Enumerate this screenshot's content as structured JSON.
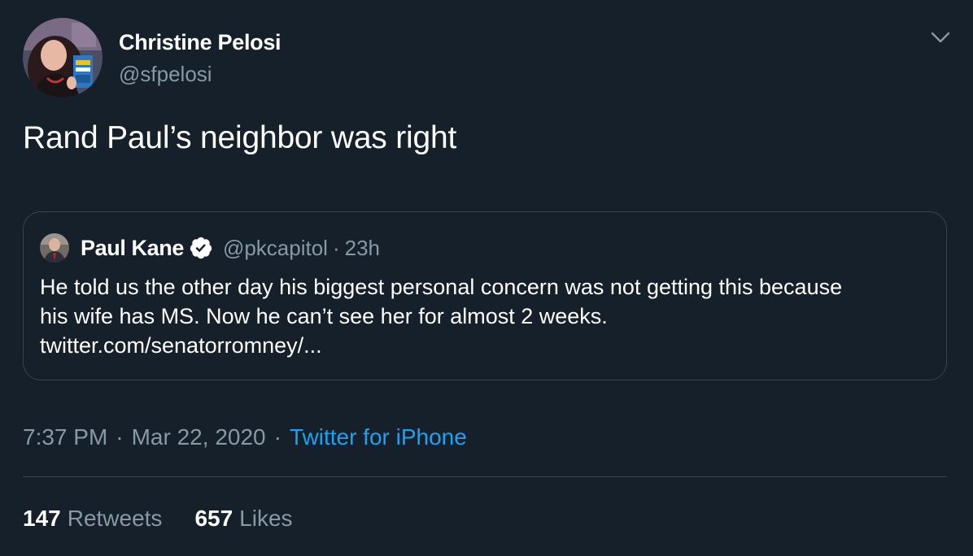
{
  "tweet": {
    "author": {
      "display_name": "Christine Pelosi",
      "handle": "@sfpelosi"
    },
    "text": "Rand Paul’s neighbor was right",
    "quoted_tweet": {
      "display_name": "Paul Kane",
      "handle": "@pkcapitol",
      "separator": "·",
      "time_ago": "23h",
      "body_lines": [
        "He told us the other day his biggest personal concern was not getting this because",
        "his wife has MS. Now he can’t see her for almost 2 weeks.",
        "twitter.com/senatorromney/..."
      ]
    },
    "meta": {
      "time": "7:37 PM",
      "separator": "·",
      "date": "Mar 22, 2020",
      "source": "Twitter for iPhone"
    },
    "stats": {
      "retweets_count": "147",
      "retweets_label": "Retweets",
      "likes_count": "657",
      "likes_label": "Likes"
    }
  },
  "icons": {
    "menu": "chevron-down-icon",
    "verified": "verified-badge-icon"
  },
  "colors": {
    "background": "#15202b",
    "border": "#38444d",
    "secondary_text": "#8899a6",
    "link": "#1da1f2"
  }
}
